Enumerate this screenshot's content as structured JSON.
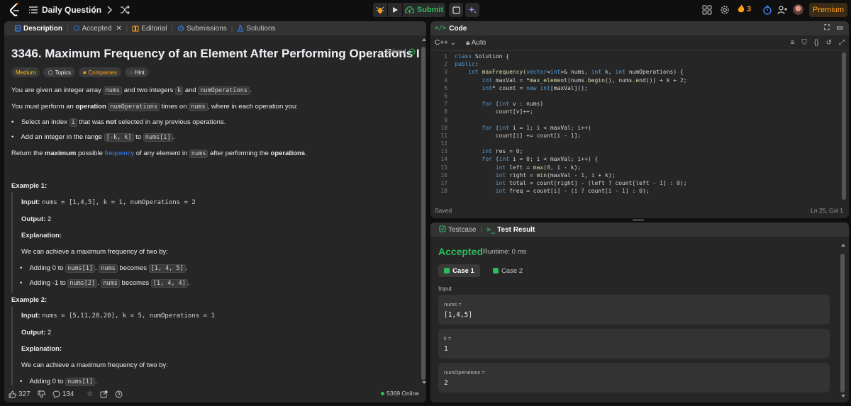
{
  "nav": {
    "title": "Daily Question",
    "submit_label": "Submit",
    "streak": "3",
    "premium_label": "Premium"
  },
  "tabs": {
    "description": "Description",
    "accepted": "Accepted",
    "editorial": "Editorial",
    "submissions": "Submissions",
    "solutions": "Solutions"
  },
  "problem": {
    "title": "3346. Maximum Frequency of an Element After Performing Operations I",
    "solved": "Solved",
    "chips": {
      "difficulty": "Medium",
      "topics": "Topics",
      "companies": "Companies",
      "hint": "Hint"
    },
    "p1_a": "You are given an integer array ",
    "p1_code1": "nums",
    "p1_b": " and two integers ",
    "p1_code2": "k",
    "p1_c": " and ",
    "p1_code3": "numOperations",
    "p1_d": ".",
    "p2_a": "You must perform an ",
    "p2_bold": "operation",
    "p2_code1": "numOperations",
    "p2_b": " times on ",
    "p2_code2": "nums",
    "p2_c": ", where in each operation you:",
    "b1_a": "Select an index ",
    "b1_code": "i",
    "b1_b": " that was ",
    "b1_bold": "not",
    "b1_c": " selected in any previous operations.",
    "b2_a": "Add an integer in the range ",
    "b2_code1": "[-k, k]",
    "b2_b": " to ",
    "b2_code2": "nums[i]",
    "b2_c": ".",
    "p3_a": "Return the ",
    "p3_bold1": "maximum",
    "p3_b": " possible ",
    "p3_link": "frequency",
    "p3_c": " of any element in ",
    "p3_code": "nums",
    "p3_d": " after performing the ",
    "p3_bold2": "operations",
    "p3_e": "."
  },
  "example1": {
    "title": "Example 1:",
    "input_label": "Input:",
    "input_value": "nums = [1,4,5], k = 1, numOperations = 2",
    "output_label": "Output:",
    "output_value": "2",
    "explanation_label": "Explanation:",
    "explanation_text": "We can achieve a maximum frequency of two by:",
    "b1_a": "Adding 0 to ",
    "b1_code1": "nums[1]",
    "b1_b": ". ",
    "b1_code2": "nums",
    "b1_c": " becomes ",
    "b1_code3": "[1, 4, 5]",
    "b1_d": ".",
    "b2_a": "Adding -1 to ",
    "b2_code1": "nums[2]",
    "b2_b": ". ",
    "b2_code2": "nums",
    "b2_c": " becomes ",
    "b2_code3": "[1, 4, 4]",
    "b2_d": "."
  },
  "example2": {
    "title": "Example 2:",
    "input_label": "Input:",
    "input_value": "nums = [5,11,20,20], k = 5, numOperations = 1",
    "output_label": "Output:",
    "output_value": "2",
    "explanation_label": "Explanation:",
    "explanation_text": "We can achieve a maximum frequency of two by:",
    "b1_a": "Adding 0 to ",
    "b1_code1": "nums[1]",
    "b1_b": "."
  },
  "footer": {
    "likes": "327",
    "comments": "134",
    "online": "5369 Online"
  },
  "code": {
    "header": "Code",
    "language": "C++",
    "mode": "Auto",
    "status": "Saved",
    "position": "Ln 25, Col 1",
    "lines": [
      "class Solution {",
      "public:",
      "    int maxFrequency(vector<int>& nums, int k, int numOperations) {",
      "        int maxVal = *max_element(nums.begin(), nums.end()) + k + 2;",
      "        int* count = new int[maxVal]();",
      "",
      "        for (int v : nums)",
      "            count[v]++;",
      "",
      "        for (int i = 1; i < maxVal; i++)",
      "            count[i] += count[i - 1];",
      "",
      "        int res = 0;",
      "        for (int i = 0; i < maxVal; i++) {",
      "            int left = max(0, i - k);",
      "            int right = min(maxVal - 1, i + k);",
      "            int total = count[right] - (left ? count[left - 1] : 0);",
      "            int freq = count[i] - (i ? count[i - 1] : 0);"
    ]
  },
  "result": {
    "testcase_tab": "Testcase",
    "result_tab": "Test Result",
    "status": "Accepted",
    "runtime": "Runtime: 0 ms",
    "case1": "Case 1",
    "case2": "Case 2",
    "input_label": "Input",
    "inputs": [
      {
        "name": "nums =",
        "value": "[1,4,5]"
      },
      {
        "name": "k =",
        "value": "1"
      },
      {
        "name": "numOperations =",
        "value": "2"
      }
    ]
  }
}
